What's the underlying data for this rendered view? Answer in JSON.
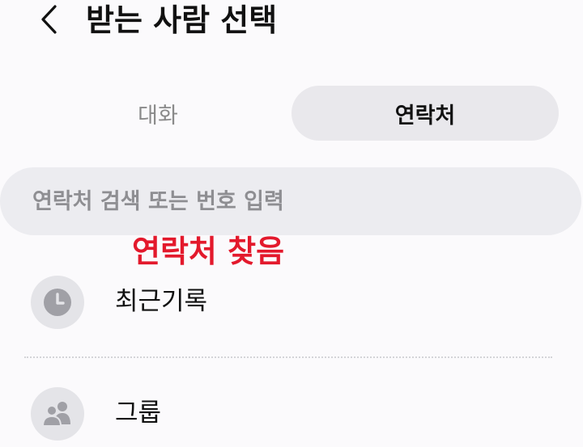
{
  "header": {
    "back_icon": "chevron-left-icon",
    "title": "받는 사람 선택"
  },
  "tabs": [
    {
      "label": "대화",
      "selected": false
    },
    {
      "label": "연락처",
      "selected": true
    }
  ],
  "search": {
    "placeholder": "연락처 검색 또는 번호 입력",
    "value": ""
  },
  "annotation": {
    "text": "연락처 찾음",
    "color": "#e3192c"
  },
  "list": [
    {
      "icon": "clock-icon",
      "label": "최근기록"
    },
    {
      "icon": "people-icon",
      "label": "그룹"
    }
  ],
  "colors": {
    "background": "#fbfafc",
    "tab_selected_bg": "#e9e8ec",
    "search_bg": "#ececf0",
    "icon_bg": "#e4e4e8",
    "icon_fg": "#a0a0a6"
  }
}
